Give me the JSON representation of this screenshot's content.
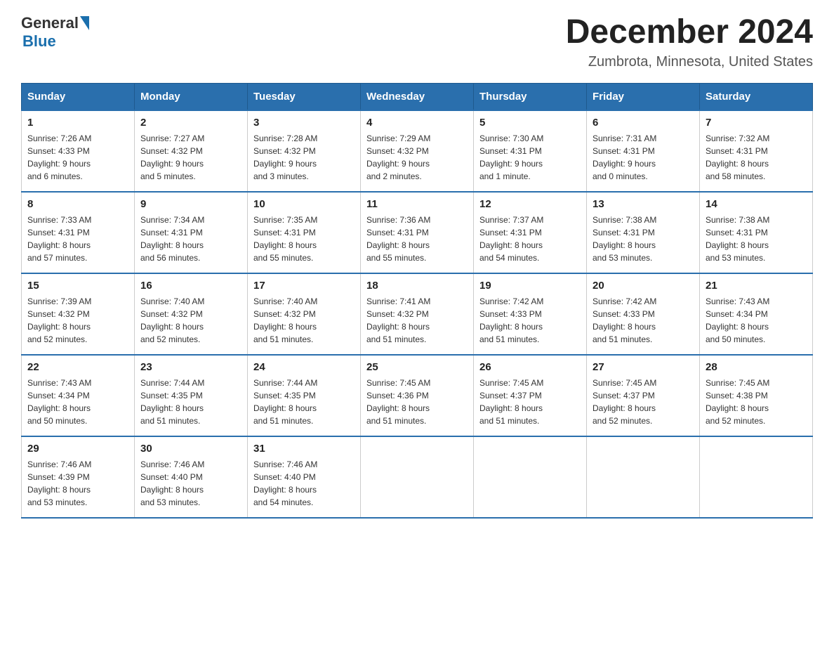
{
  "header": {
    "logo_general": "General",
    "logo_blue": "Blue",
    "title": "December 2024",
    "subtitle": "Zumbrota, Minnesota, United States"
  },
  "days_of_week": [
    "Sunday",
    "Monday",
    "Tuesday",
    "Wednesday",
    "Thursday",
    "Friday",
    "Saturday"
  ],
  "weeks": [
    [
      {
        "num": "1",
        "sunrise": "7:26 AM",
        "sunset": "4:33 PM",
        "daylight_h": "9 hours",
        "daylight_m": "and 6 minutes."
      },
      {
        "num": "2",
        "sunrise": "7:27 AM",
        "sunset": "4:32 PM",
        "daylight_h": "9 hours",
        "daylight_m": "and 5 minutes."
      },
      {
        "num": "3",
        "sunrise": "7:28 AM",
        "sunset": "4:32 PM",
        "daylight_h": "9 hours",
        "daylight_m": "and 3 minutes."
      },
      {
        "num": "4",
        "sunrise": "7:29 AM",
        "sunset": "4:32 PM",
        "daylight_h": "9 hours",
        "daylight_m": "and 2 minutes."
      },
      {
        "num": "5",
        "sunrise": "7:30 AM",
        "sunset": "4:31 PM",
        "daylight_h": "9 hours",
        "daylight_m": "and 1 minute."
      },
      {
        "num": "6",
        "sunrise": "7:31 AM",
        "sunset": "4:31 PM",
        "daylight_h": "9 hours",
        "daylight_m": "and 0 minutes."
      },
      {
        "num": "7",
        "sunrise": "7:32 AM",
        "sunset": "4:31 PM",
        "daylight_h": "8 hours",
        "daylight_m": "and 58 minutes."
      }
    ],
    [
      {
        "num": "8",
        "sunrise": "7:33 AM",
        "sunset": "4:31 PM",
        "daylight_h": "8 hours",
        "daylight_m": "and 57 minutes."
      },
      {
        "num": "9",
        "sunrise": "7:34 AM",
        "sunset": "4:31 PM",
        "daylight_h": "8 hours",
        "daylight_m": "and 56 minutes."
      },
      {
        "num": "10",
        "sunrise": "7:35 AM",
        "sunset": "4:31 PM",
        "daylight_h": "8 hours",
        "daylight_m": "and 55 minutes."
      },
      {
        "num": "11",
        "sunrise": "7:36 AM",
        "sunset": "4:31 PM",
        "daylight_h": "8 hours",
        "daylight_m": "and 55 minutes."
      },
      {
        "num": "12",
        "sunrise": "7:37 AM",
        "sunset": "4:31 PM",
        "daylight_h": "8 hours",
        "daylight_m": "and 54 minutes."
      },
      {
        "num": "13",
        "sunrise": "7:38 AM",
        "sunset": "4:31 PM",
        "daylight_h": "8 hours",
        "daylight_m": "and 53 minutes."
      },
      {
        "num": "14",
        "sunrise": "7:38 AM",
        "sunset": "4:31 PM",
        "daylight_h": "8 hours",
        "daylight_m": "and 53 minutes."
      }
    ],
    [
      {
        "num": "15",
        "sunrise": "7:39 AM",
        "sunset": "4:32 PM",
        "daylight_h": "8 hours",
        "daylight_m": "and 52 minutes."
      },
      {
        "num": "16",
        "sunrise": "7:40 AM",
        "sunset": "4:32 PM",
        "daylight_h": "8 hours",
        "daylight_m": "and 52 minutes."
      },
      {
        "num": "17",
        "sunrise": "7:40 AM",
        "sunset": "4:32 PM",
        "daylight_h": "8 hours",
        "daylight_m": "and 51 minutes."
      },
      {
        "num": "18",
        "sunrise": "7:41 AM",
        "sunset": "4:32 PM",
        "daylight_h": "8 hours",
        "daylight_m": "and 51 minutes."
      },
      {
        "num": "19",
        "sunrise": "7:42 AM",
        "sunset": "4:33 PM",
        "daylight_h": "8 hours",
        "daylight_m": "and 51 minutes."
      },
      {
        "num": "20",
        "sunrise": "7:42 AM",
        "sunset": "4:33 PM",
        "daylight_h": "8 hours",
        "daylight_m": "and 51 minutes."
      },
      {
        "num": "21",
        "sunrise": "7:43 AM",
        "sunset": "4:34 PM",
        "daylight_h": "8 hours",
        "daylight_m": "and 50 minutes."
      }
    ],
    [
      {
        "num": "22",
        "sunrise": "7:43 AM",
        "sunset": "4:34 PM",
        "daylight_h": "8 hours",
        "daylight_m": "and 50 minutes."
      },
      {
        "num": "23",
        "sunrise": "7:44 AM",
        "sunset": "4:35 PM",
        "daylight_h": "8 hours",
        "daylight_m": "and 51 minutes."
      },
      {
        "num": "24",
        "sunrise": "7:44 AM",
        "sunset": "4:35 PM",
        "daylight_h": "8 hours",
        "daylight_m": "and 51 minutes."
      },
      {
        "num": "25",
        "sunrise": "7:45 AM",
        "sunset": "4:36 PM",
        "daylight_h": "8 hours",
        "daylight_m": "and 51 minutes."
      },
      {
        "num": "26",
        "sunrise": "7:45 AM",
        "sunset": "4:37 PM",
        "daylight_h": "8 hours",
        "daylight_m": "and 51 minutes."
      },
      {
        "num": "27",
        "sunrise": "7:45 AM",
        "sunset": "4:37 PM",
        "daylight_h": "8 hours",
        "daylight_m": "and 52 minutes."
      },
      {
        "num": "28",
        "sunrise": "7:45 AM",
        "sunset": "4:38 PM",
        "daylight_h": "8 hours",
        "daylight_m": "and 52 minutes."
      }
    ],
    [
      {
        "num": "29",
        "sunrise": "7:46 AM",
        "sunset": "4:39 PM",
        "daylight_h": "8 hours",
        "daylight_m": "and 53 minutes."
      },
      {
        "num": "30",
        "sunrise": "7:46 AM",
        "sunset": "4:40 PM",
        "daylight_h": "8 hours",
        "daylight_m": "and 53 minutes."
      },
      {
        "num": "31",
        "sunrise": "7:46 AM",
        "sunset": "4:40 PM",
        "daylight_h": "8 hours",
        "daylight_m": "and 54 minutes."
      },
      null,
      null,
      null,
      null
    ]
  ],
  "labels": {
    "sunrise": "Sunrise:",
    "sunset": "Sunset:",
    "daylight": "Daylight:"
  }
}
